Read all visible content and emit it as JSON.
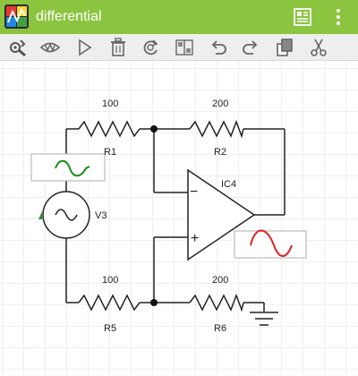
{
  "app": {
    "title": "differential",
    "accent_color": "#8bc43f",
    "icons": [
      "app-logo-icon",
      "component-list-icon",
      "overflow-menu-icon"
    ]
  },
  "toolbar": {
    "tools": [
      "wrench-settings-icon",
      "eye-view-icon",
      "play-simulate-icon",
      "trash-delete-icon",
      "rotate-icon",
      "flip-mirror-icon",
      "undo-icon",
      "redo-icon",
      "copy-icon",
      "scissors-cut-icon"
    ]
  },
  "schematic": {
    "components": {
      "R1": {
        "label": "R1",
        "value": "100"
      },
      "R2": {
        "label": "R2",
        "value": "200"
      },
      "R5": {
        "label": "R5",
        "value": "100"
      },
      "R6": {
        "label": "R6",
        "value": "200"
      },
      "V3": {
        "label": "V3"
      },
      "IC4": {
        "label": "IC4",
        "minus_sign": "−",
        "plus_sign": "+"
      }
    },
    "colors": {
      "wire": "#222222",
      "input_wave": "#1a8a1a",
      "output_wave": "#dd2222"
    }
  }
}
